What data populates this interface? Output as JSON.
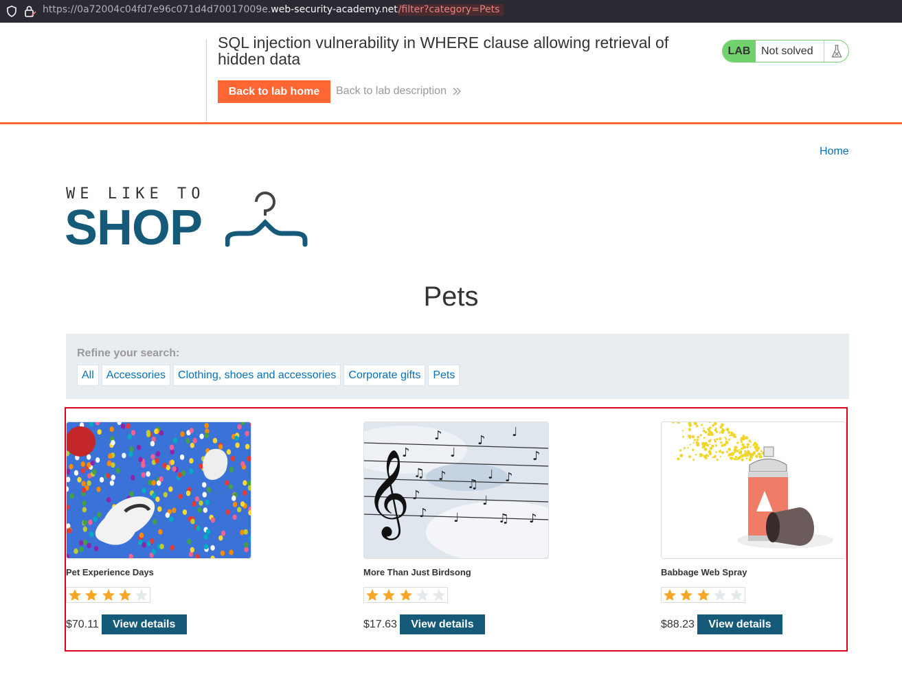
{
  "browser": {
    "url_prefix": "https://0a72004c04fd7e96c071d4d70017009e.",
    "url_domain": "web-security-academy.net",
    "url_path": "/filter?category=Pets"
  },
  "lab": {
    "title": "SQL injection vulnerability in WHERE clause allowing retrieval of hidden data",
    "back_home": "Back to lab home",
    "back_desc": "Back to lab description",
    "badge_lab": "LAB",
    "badge_status": "Not solved"
  },
  "nav": {
    "home": "Home"
  },
  "logo": {
    "tagline": "WE LIKE TO",
    "word": "SHOP"
  },
  "page": {
    "title": "Pets"
  },
  "filter": {
    "label": "Refine your search:",
    "categories": [
      "All",
      "Accessories",
      "Clothing, shoes and accessories",
      "Corporate gifts",
      "Pets"
    ]
  },
  "products": [
    {
      "name": "Pet Experience Days",
      "rating": 4,
      "price": "$70.11",
      "button": "View details"
    },
    {
      "name": "More Than Just Birdsong",
      "rating": 3,
      "price": "$17.63",
      "button": "View details"
    },
    {
      "name": "Babbage Web Spray",
      "rating": 3,
      "price": "$88.23",
      "button": "View details"
    }
  ],
  "colors": {
    "accent": "#ff6633",
    "brand": "#165a79",
    "link": "#0071bc",
    "highlight": "#e0001b",
    "star": "#f5a623"
  }
}
